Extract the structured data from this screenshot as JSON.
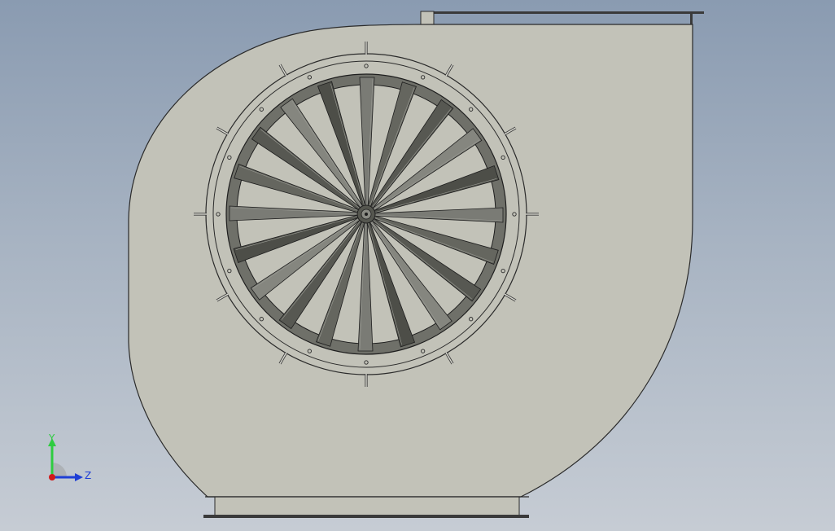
{
  "view": {
    "background_top": "#8a9bb1",
    "background_bottom": "#c6ccd4",
    "housing_fill": "#c2c2b8",
    "housing_stroke": "#2a2a2a",
    "impeller_ring_fill": "#6f7069",
    "blade_colors": [
      "#7a7b75",
      "#65665f",
      "#575852",
      "#85867f",
      "#4d4e48"
    ]
  },
  "model": {
    "blade_count": 20,
    "bolt_count": 16,
    "stud_count": 12
  },
  "triad": {
    "y_label": "Y",
    "z_label": "Z",
    "y_color": "#2ecc40",
    "z_color": "#1f3fd6",
    "origin_color": "#d11a1a"
  }
}
